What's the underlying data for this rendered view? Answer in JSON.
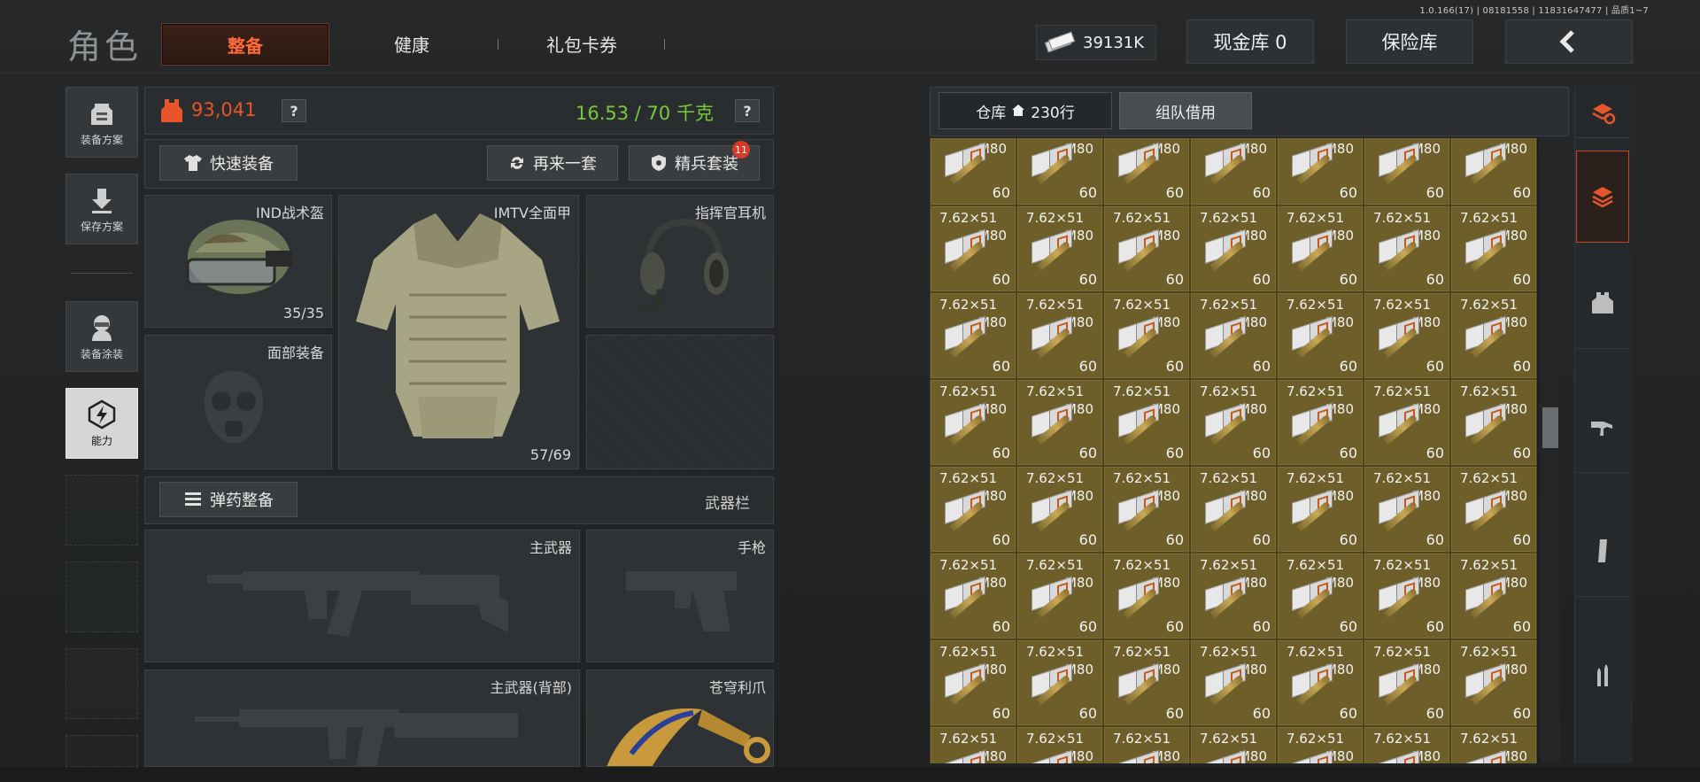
{
  "version": "1.0.166(17) | 08181558 | 11831647477 | 品质1~7",
  "title": "角色",
  "tabs": [
    {
      "label": "整备",
      "active": true
    },
    {
      "label": "健康",
      "active": false
    },
    {
      "label": "礼包卡券",
      "active": false
    }
  ],
  "topbar": {
    "money": "39131K",
    "cash_vault": "现金库 0",
    "insurance": "保险库",
    "back_icon": "chevron-left-icon"
  },
  "sidebar": {
    "items": [
      {
        "label": "装备方案",
        "icon": "backpack-icon"
      },
      {
        "label": "保存方案",
        "icon": "download-icon"
      },
      {
        "label": "装备涂装",
        "icon": "soldier-icon"
      },
      {
        "label": "能力",
        "icon": "lightning-icon",
        "active": true
      }
    ]
  },
  "stats": {
    "armor_value": "93,041",
    "weight": "16.53 / 70 千克",
    "help": "?"
  },
  "actions": {
    "quick_equip": "快速装备",
    "again": "再来一套",
    "elite": "精兵套装",
    "elite_badge": "11",
    "ammo_equip": "弹药整备",
    "weapon_bar": "武器栏"
  },
  "slots": {
    "helmet": {
      "name": "IND战术盔",
      "count": "35/35"
    },
    "armor": {
      "name": "IMTV全面甲",
      "count": "57/69"
    },
    "headset": {
      "name": "指挥官耳机"
    },
    "face": {
      "name": "面部装备"
    },
    "primary": {
      "name": "主武器"
    },
    "pistol": {
      "name": "手枪"
    },
    "primary_back": {
      "name": "主武器(背部)"
    },
    "melee": {
      "name": "苍穹利爪"
    }
  },
  "warehouse": {
    "tab_storage": "仓库",
    "rows": "230行",
    "tab_team": "组队借用",
    "item": {
      "caliber": "7.62×51",
      "model": "M80",
      "quantity": "60"
    }
  },
  "right_categories": [
    "stack-refresh-icon",
    "stack-icon",
    "armor-icon",
    "rifle-icon",
    "magazine-icon",
    "bullet-icon"
  ],
  "colors": {
    "accent": "#ff6a3a",
    "weight": "#79c93a",
    "ammo_cell": "#6e5f2a",
    "badge": "#d83a2a"
  }
}
